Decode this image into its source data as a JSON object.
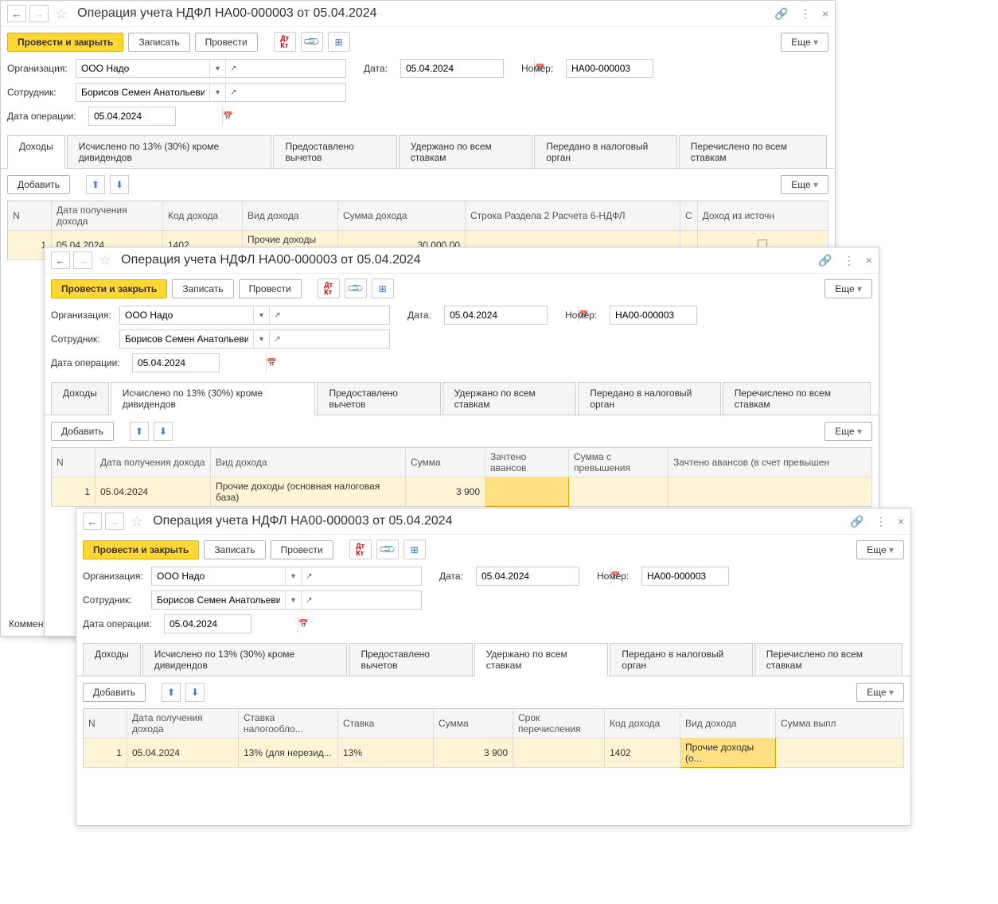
{
  "title": "Операция учета НДФЛ НА00-000003 от 05.04.2024",
  "toolbar": {
    "post_close": "Провести и закрыть",
    "record": "Записать",
    "post": "Провести",
    "more": "Еще"
  },
  "fields": {
    "org_label": "Организация:",
    "org_value": "ООО Надо",
    "date_label": "Дата:",
    "date_value": "05.04.2024",
    "num_label": "Номер:",
    "num_value": "НА00-000003",
    "emp_label": "Сотрудник:",
    "emp_value": "Борисов Семен Анатольевич",
    "opdate_label": "Дата операции:",
    "opdate_value": "05.04.2024"
  },
  "tabs": {
    "income": "Доходы",
    "calc13": "Исчислено по 13% (30%) кроме дивидендов",
    "deduct": "Предоставлено вычетов",
    "withheld": "Удержано по всем ставкам",
    "tax_auth": "Передано в налоговый орган",
    "transferred": "Перечислено по всем ставкам"
  },
  "sub": {
    "add": "Добавить",
    "more": "Еще"
  },
  "table1": {
    "cols": {
      "n": "N",
      "date": "Дата получения дохода",
      "code": "Код дохода",
      "type": "Вид дохода",
      "sum": "Сумма дохода",
      "line6": "Строка Раздела 2 Расчета 6-НДФЛ",
      "c": "С",
      "src": "Доход из источн"
    },
    "row": {
      "n": "1",
      "date": "05.04.2024",
      "code": "1402",
      "type": "Прочие доходы (о...",
      "sum": "30 000,00"
    }
  },
  "table2": {
    "cols": {
      "n": "N",
      "date": "Дата получения дохода",
      "type": "Вид дохода",
      "sum": "Сумма",
      "adv": "Зачтено авансов",
      "excess": "Сумма с превышения",
      "adv_excess": "Зачтено авансов (в счет превышен"
    },
    "row": {
      "n": "1",
      "date": "05.04.2024",
      "type": "Прочие доходы (основная налоговая база)",
      "sum": "3 900"
    }
  },
  "table3": {
    "cols": {
      "n": "N",
      "date": "Дата получения дохода",
      "rate_base": "Ставка налогообло...",
      "rate": "Ставка",
      "sum": "Сумма",
      "term": "Срок перечисления",
      "code": "Код дохода",
      "type": "Вид дохода",
      "payout": "Сумма выпл"
    },
    "row": {
      "n": "1",
      "date": "05.04.2024",
      "rate_base": "13% (для нерезид...",
      "rate": "13%",
      "sum": "3 900",
      "code": "1402",
      "type": "Прочие доходы (о..."
    }
  },
  "comment": "Коммент"
}
